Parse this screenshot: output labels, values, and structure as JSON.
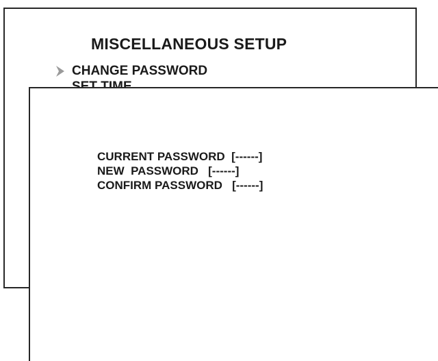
{
  "menu": {
    "title": "MISCELLANEOUS SETUP",
    "cursor_icon": "chevron-right-icon",
    "items": [
      {
        "label": "CHANGE PASSWORD",
        "selected": true
      },
      {
        "label": "SET TIME",
        "selected": false
      }
    ]
  },
  "password_dialog": {
    "rows": [
      {
        "label": "CURRENT PASSWORD",
        "value": "[------]"
      },
      {
        "label": "NEW  PASSWORD",
        "value": "[------]"
      },
      {
        "label": "CONFIRM PASSWORD",
        "value": "[------]"
      }
    ]
  },
  "colors": {
    "text": "#1a1a1a",
    "border": "#262626",
    "cursor": "#9a9a9a",
    "background": "#ffffff"
  }
}
